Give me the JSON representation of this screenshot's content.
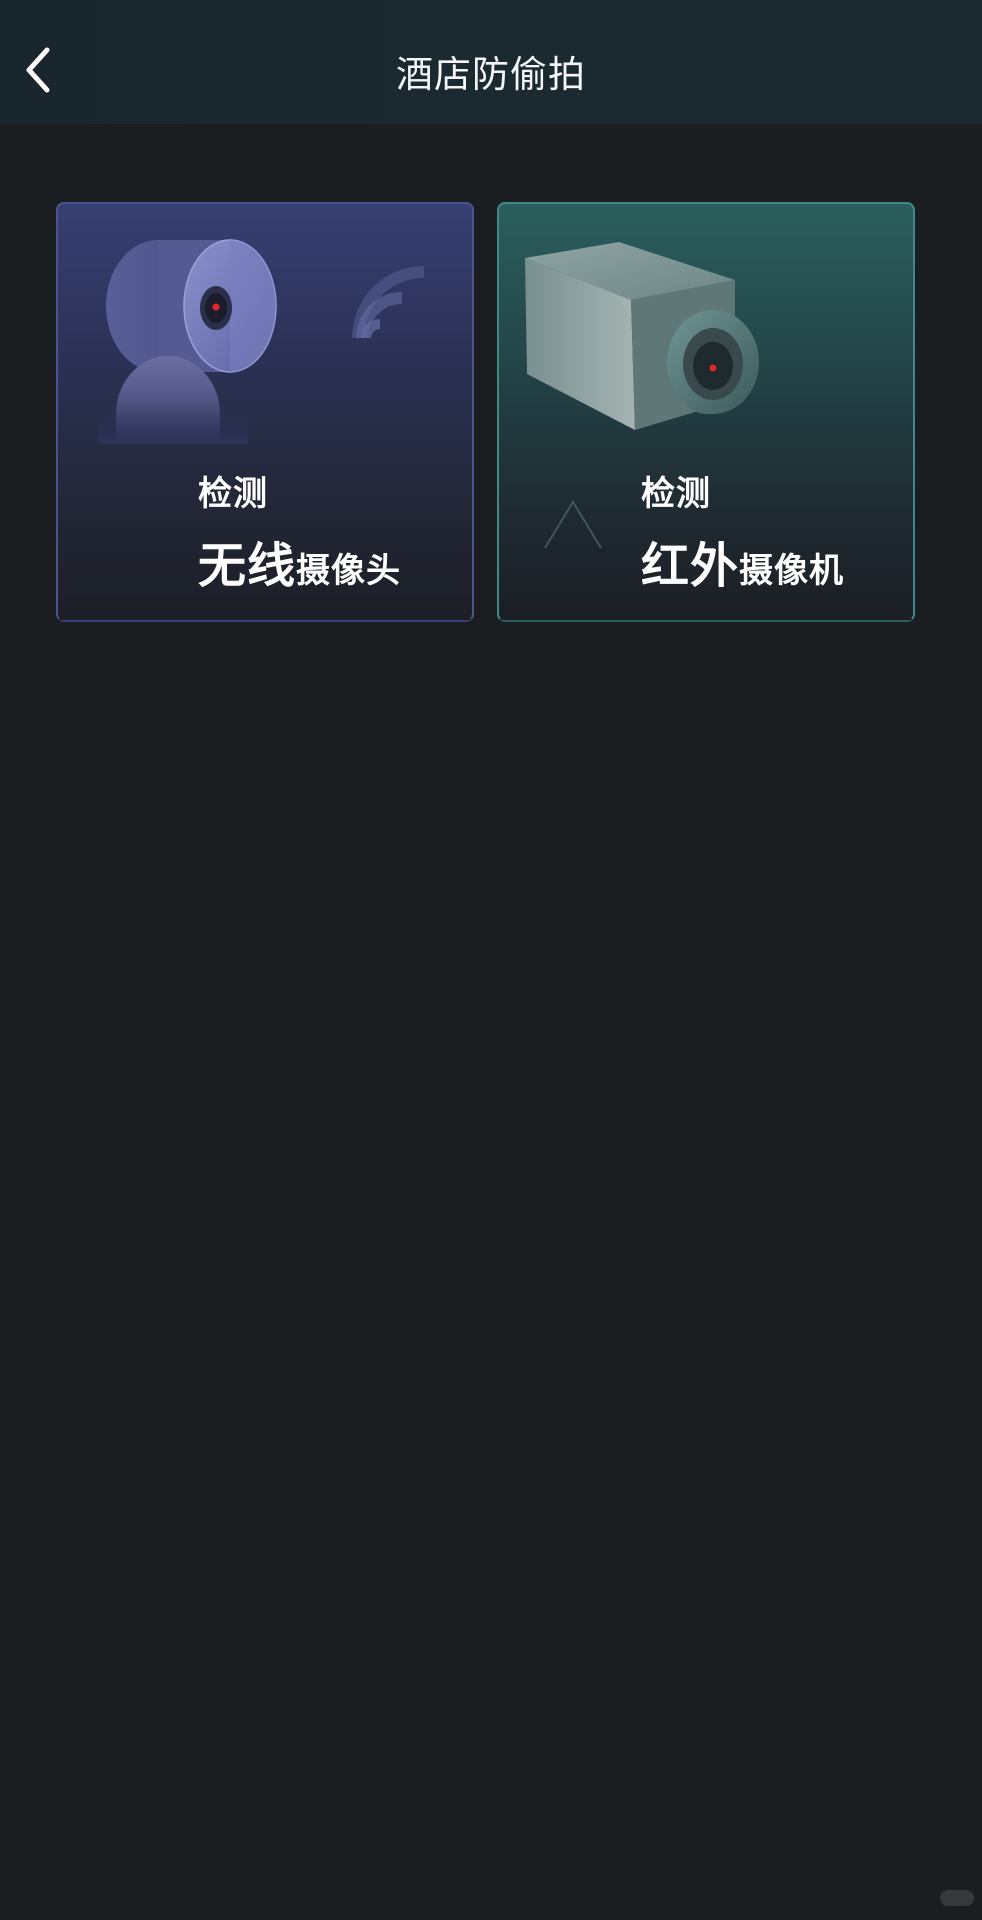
{
  "header": {
    "title": "酒店防偷拍",
    "back_icon": "chevron-left-icon"
  },
  "cards": [
    {
      "label_small": "检测",
      "label_big": "无线",
      "label_mid": "摄像头",
      "icon": "wireless-camera-icon",
      "accent": "#4a5590"
    },
    {
      "label_small": "检测",
      "label_big": "红外",
      "label_mid": "摄像机",
      "icon": "infrared-camera-icon",
      "accent": "#3f8a86"
    }
  ],
  "colors": {
    "background": "#1b1e21",
    "header": "#1b2a31",
    "lens_dot": "#e0262a"
  }
}
